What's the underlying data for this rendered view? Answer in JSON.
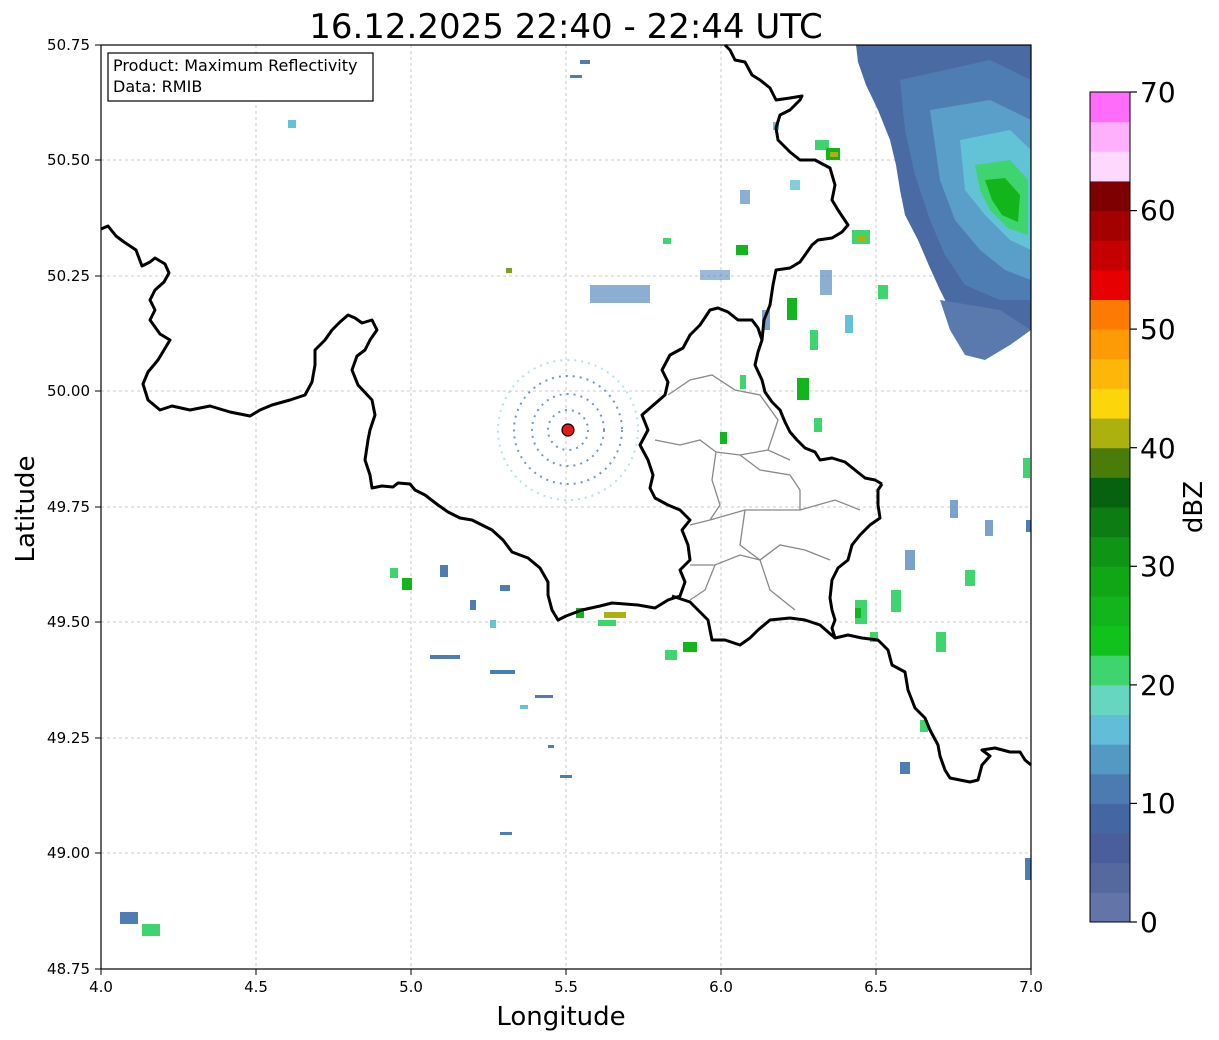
{
  "title": "16.12.2025 22:40 - 22:44 UTC",
  "info_box": {
    "product": "Product: Maximum Reflectivity",
    "data": "Data: RMIB"
  },
  "axes": {
    "xlabel": "Longitude",
    "ylabel": "Latitude",
    "xlim": [
      4.0,
      7.0
    ],
    "ylim": [
      48.75,
      50.75
    ],
    "xticks": [
      "4.0",
      "4.5",
      "5.0",
      "5.5",
      "6.0",
      "6.5",
      "7.0"
    ],
    "yticks": [
      "48.75",
      "49.00",
      "49.25",
      "49.50",
      "49.75",
      "50.00",
      "50.25",
      "50.50",
      "50.75"
    ],
    "grid": true
  },
  "colorbar": {
    "label": "dBZ",
    "range": [
      0,
      70
    ],
    "ticks": [
      "0",
      "10",
      "20",
      "30",
      "40",
      "50",
      "60",
      "70"
    ],
    "step": 2.5,
    "colors": [
      "#6374a8",
      "#56699f",
      "#4a5e9c",
      "#4466a3",
      "#4b7bb1",
      "#5499c4",
      "#62bdd9",
      "#66d6c1",
      "#3ed56e",
      "#11c11c",
      "#12b51b",
      "#10a615",
      "#0f9415",
      "#0c7c13",
      "#07620f",
      "#4a7c0a",
      "#adb10e",
      "#fcd60a",
      "#fdb709",
      "#fd9b06",
      "#fd7a03",
      "#e60000",
      "#c50000",
      "#a50000",
      "#7e0000",
      "#ffd9fd",
      "#ffb0fc",
      "#ff6cf9",
      "#ee35ee"
    ]
  },
  "radar_site": {
    "lon": 5.51,
    "lat": 49.92,
    "color": "#e31a1c"
  },
  "colors": {
    "border": "#000000",
    "admin": "#888888",
    "grid": "#bbbbbb"
  }
}
